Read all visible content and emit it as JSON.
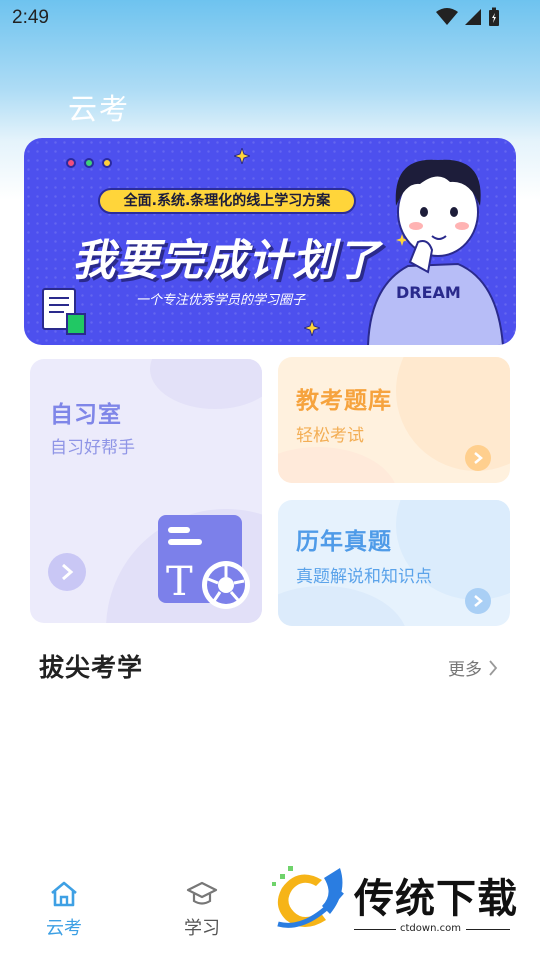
{
  "status_bar": {
    "time": "2:49"
  },
  "header": {
    "app_title": "云考"
  },
  "banner": {
    "tagline": "全面.系统.条理化的线上学习方案",
    "headline": "我要完成计划了",
    "subline": "一个专注优秀学员的学习圈子",
    "shirt_text": "DREAM",
    "colors": {
      "background": "#4d50ee",
      "pill": "#ffd53a"
    }
  },
  "cards": {
    "study_room": {
      "title": "自习室",
      "subtitle": "自习好帮手",
      "color": "#7f86e8"
    },
    "question_bank": {
      "title": "教考题库",
      "subtitle": "轻松考试",
      "color": "#f6a33e"
    },
    "past_exams": {
      "title": "历年真题",
      "subtitle": "真题解说和知识点",
      "color": "#4f9be8"
    }
  },
  "section": {
    "title": "拔尖考学",
    "more_label": "更多"
  },
  "bottom_nav": {
    "items": [
      {
        "label": "云考",
        "icon": "home-icon",
        "active": true
      },
      {
        "label": "学习",
        "icon": "graduation-cap-icon",
        "active": false
      }
    ],
    "active_color": "#3ea0e4"
  },
  "watermark": {
    "name": "传统下载",
    "domain": "ctdown.com"
  }
}
